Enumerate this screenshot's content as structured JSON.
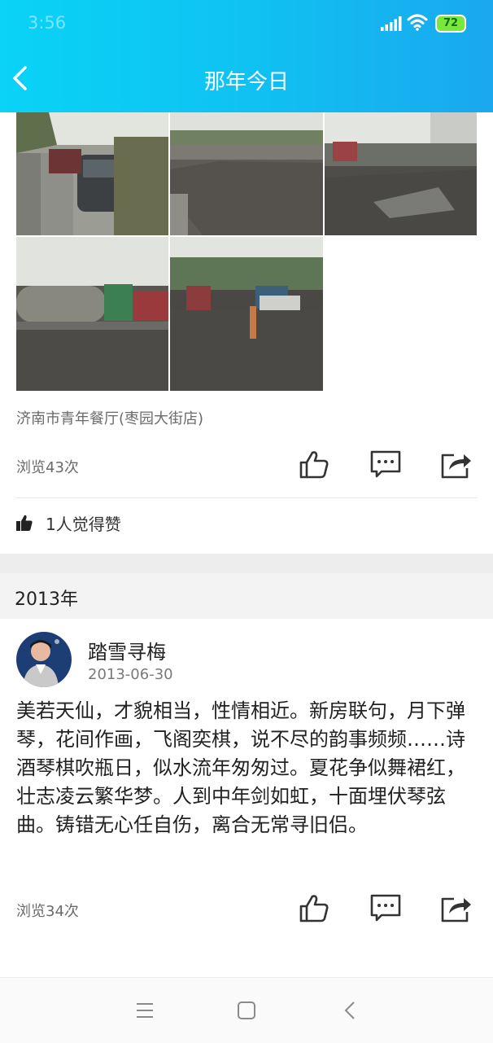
{
  "status": {
    "time": "3:56",
    "battery": "72"
  },
  "header": {
    "title": "那年今日"
  },
  "post1": {
    "location": "济南市青年餐厅(枣园大街店)",
    "views": "浏览43次",
    "liked_text": "1人觉得赞"
  },
  "section": {
    "year": "2013年"
  },
  "post2": {
    "author": "踏雪寻梅",
    "date": "2013-06-30",
    "text": "美若天仙，才貌相当，性情相近。新房联句，月下弹琴，花间作画，飞阁奕棋，说不尽的韵事频频……诗酒琴棋吹瓶日，似水流年匆匆过。夏花争似舞裙红，壮志凌云繁华梦。人到中年剑如虹，十面埋伏琴弦曲。铸错无心任自伤，离合无常寻旧侣。",
    "views": "浏览34次"
  },
  "icons": {
    "back": "back-arrow-icon",
    "like": "thumb-up-icon",
    "comment": "comment-bubble-icon",
    "share": "share-icon",
    "menu": "menu-icon",
    "home": "home-square-icon",
    "nav_back": "nav-back-icon"
  },
  "colors": {
    "header_start": "#0ad3f6",
    "header_end": "#1aa8ee",
    "battery": "#7be63d"
  }
}
